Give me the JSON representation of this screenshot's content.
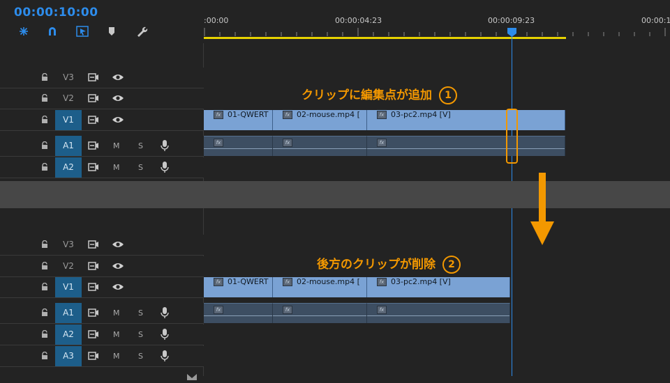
{
  "timecode": "00:00:10:00",
  "toolbar": {
    "icons": [
      "ripple-icon",
      "snap-magnet-icon",
      "linked-selection-icon",
      "marker-icon",
      "wrench-icon"
    ]
  },
  "ruler": {
    "labels": [
      ":00:00",
      "00:00:04:23",
      "00:00:09:23",
      "00:00:1"
    ]
  },
  "top_panel": {
    "video_tracks": [
      "V3",
      "V2",
      "V1"
    ],
    "audio_tracks": [
      "A1",
      "A2"
    ],
    "clips": [
      "01-QWERT",
      "02-mouse.mp4 [",
      "03-pc2.mp4 [V]"
    ],
    "annotation": "クリップに編集点が追加",
    "annotation_number": "1"
  },
  "bottom_panel": {
    "video_tracks": [
      "V3",
      "V2",
      "V1"
    ],
    "audio_tracks": [
      "A1",
      "A2",
      "A3"
    ],
    "clips": [
      "01-QWERT",
      "02-mouse.mp4 [",
      "03-pc2.mp4 [V]"
    ],
    "annotation": "後方のクリップが削除",
    "annotation_number": "2"
  },
  "audio_labels": {
    "mute": "M",
    "solo": "S"
  },
  "fx_label": "fx",
  "colors": {
    "accent_blue": "#2d8ceb",
    "annotation_orange": "#f39800",
    "work_area_yellow": "#e6d200",
    "clip_blue": "#7aa2d4",
    "track_target": "#1d5e8a"
  }
}
